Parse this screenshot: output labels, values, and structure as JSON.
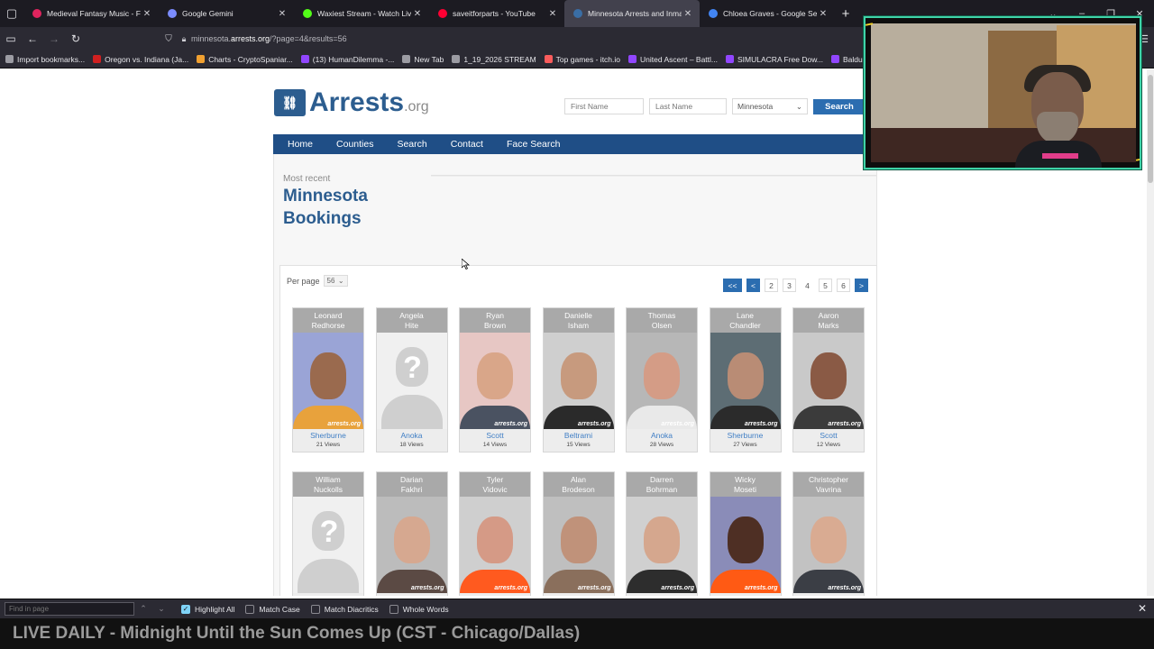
{
  "tabs": [
    {
      "title": "Medieval Fantasy Music - F",
      "fav_color": "#e0245e",
      "active": false
    },
    {
      "title": "Google Gemini",
      "fav_color": "#7b8cff",
      "active": false
    },
    {
      "title": "Waxiest Stream - Watch Live on",
      "fav_color": "#53fc18",
      "active": false
    },
    {
      "title": "saveitforparts - YouTube",
      "fav_color": "#ff0033",
      "active": false
    },
    {
      "title": "Minnesota Arrests and Inmate",
      "fav_color": "#3a6ea5",
      "active": true
    },
    {
      "title": "Chloea Graves - Google Search",
      "fav_color": "#4285f4",
      "active": false
    }
  ],
  "address": {
    "prefix": "minnesota.",
    "domain": "arrests.org",
    "path": "/?page=4&results=56"
  },
  "bookmarks": [
    {
      "label": "Import bookmarks...",
      "color": "#9c9ca3"
    },
    {
      "label": "Oregon vs. Indiana (Ja...",
      "color": "#d02020"
    },
    {
      "label": "Charts - CryptoSpaniar...",
      "color": "#f0a030"
    },
    {
      "label": "(13) HumanDilemma -...",
      "color": "#9146ff"
    },
    {
      "label": "New Tab",
      "color": "#9c9ca3"
    },
    {
      "label": "1_19_2026 STREAM",
      "color": "#9c9ca3"
    },
    {
      "label": "Top games - itch.io",
      "color": "#fa5c5c"
    },
    {
      "label": "United Ascent – Battl...",
      "color": "#9146ff"
    },
    {
      "label": "SIMULACRA Free Dow...",
      "color": "#9146ff"
    },
    {
      "label": "Baldur's Gate II: Enhan...",
      "color": "#9146ff"
    }
  ],
  "site": {
    "logo_main": "Arrests",
    "logo_ext": ".org",
    "first_name_placeholder": "First Name",
    "last_name_placeholder": "Last Name",
    "state_selected": "Minnesota",
    "search_label": "Search",
    "nav": [
      "Home",
      "Counties",
      "Search",
      "Contact",
      "Face Search"
    ],
    "most_recent": "Most recent",
    "heading": "Minnesota Bookings",
    "per_page_label": "Per page",
    "per_page_value": "56",
    "pager": [
      "<<",
      "<",
      "2",
      "3",
      "4",
      "5",
      "6",
      ">"
    ],
    "current_page": "4"
  },
  "bookings": [
    {
      "first": "Leonard",
      "last": "Redhorse",
      "county": "Sherburne",
      "views": "21 Views",
      "skin": "#9a6a4e",
      "shirt": "#e8a23c",
      "bg": "#9aa4d6",
      "known": true
    },
    {
      "first": "Angela",
      "last": "Hite",
      "county": "Anoka",
      "views": "18 Views",
      "known": false
    },
    {
      "first": "Ryan",
      "last": "Brown",
      "county": "Scott",
      "views": "14 Views",
      "skin": "#d9a689",
      "shirt": "#4a5261",
      "bg": "#e7c7c4",
      "known": true
    },
    {
      "first": "Danielle",
      "last": "Isham",
      "county": "Beltrami",
      "views": "15 Views",
      "skin": "#c79a7e",
      "shirt": "#2a2a2a",
      "bg": "#cfcfcf",
      "known": true
    },
    {
      "first": "Thomas",
      "last": "Olsen",
      "county": "Anoka",
      "views": "28 Views",
      "skin": "#d49c86",
      "shirt": "#e9e9e9",
      "bg": "#b7b7b7",
      "known": true
    },
    {
      "first": "Lane",
      "last": "Chandler",
      "county": "Sherburne",
      "views": "27 Views",
      "skin": "#b98c75",
      "shirt": "#2b2b2b",
      "bg": "#5d6d74",
      "known": true
    },
    {
      "first": "Aaron",
      "last": "Marks",
      "county": "Scott",
      "views": "12 Views",
      "skin": "#8a5a45",
      "shirt": "#3b3b3b",
      "bg": "#c9c9c9",
      "known": true
    },
    {
      "first": "William",
      "last": "Nuckolls",
      "county": "",
      "views": "",
      "known": false
    },
    {
      "first": "Darian",
      "last": "Fakhri",
      "county": "",
      "views": "",
      "skin": "#d6a890",
      "shirt": "#5b4a44",
      "bg": "#bcbcbc",
      "known": true
    },
    {
      "first": "Tyler",
      "last": "Vidovic",
      "county": "",
      "views": "",
      "skin": "#d59a86",
      "shirt": "#ff5a1f",
      "bg": "#cfcfcf",
      "known": true
    },
    {
      "first": "Alan",
      "last": "Brodeson",
      "county": "",
      "views": "",
      "skin": "#c0927a",
      "shirt": "#8a6f5c",
      "bg": "#bfbfbf",
      "known": true
    },
    {
      "first": "Darren",
      "last": "Bohrman",
      "county": "",
      "views": "",
      "skin": "#d5a78e",
      "shirt": "#2d2d2d",
      "bg": "#d0d0d0",
      "known": true
    },
    {
      "first": "Wicky",
      "last": "Moseti",
      "county": "",
      "views": "",
      "skin": "#4e2f24",
      "shirt": "#ff5a14",
      "bg": "#8a8cb8",
      "known": true
    },
    {
      "first": "Christopher",
      "last": "Vavrina",
      "county": "",
      "views": "",
      "skin": "#d9ab92",
      "shirt": "#3b3e45",
      "bg": "#c2c2c2",
      "known": true
    }
  ],
  "watermark": "arrests.org",
  "find_bar": {
    "placeholder": "Find in page",
    "options": [
      {
        "label": "Highlight All",
        "checked": true
      },
      {
        "label": "Match Case",
        "checked": false
      },
      {
        "label": "Match Diacritics",
        "checked": false
      },
      {
        "label": "Whole Words",
        "checked": false
      }
    ]
  },
  "ticker": "LIVE DAILY - Midnight Until the Sun Comes Up (CST - Chicago/Dallas)"
}
